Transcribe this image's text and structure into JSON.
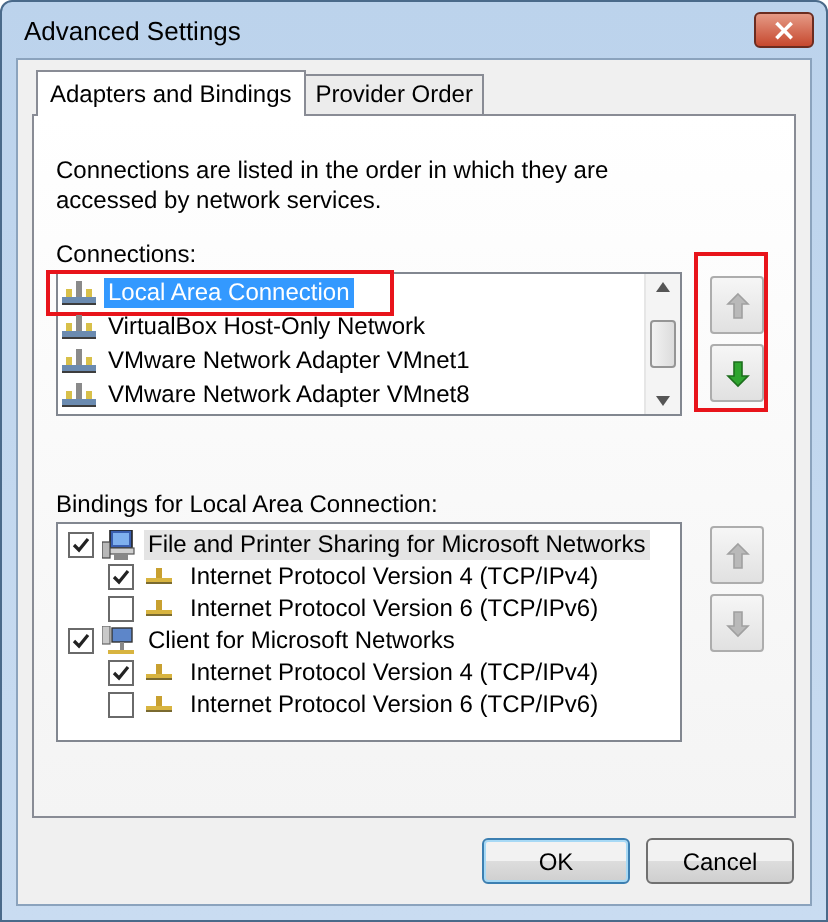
{
  "window": {
    "title": "Advanced Settings",
    "close_label": "×"
  },
  "tabs": [
    {
      "label": "Adapters and Bindings",
      "selected": true
    },
    {
      "label": "Provider Order",
      "selected": false
    }
  ],
  "description": "Connections are listed in the order in which they are accessed by network services.",
  "connections": {
    "label": "Connections:",
    "highlighted": true,
    "items": [
      {
        "name": "Local Area Connection",
        "selected": true,
        "highlighted": true
      },
      {
        "name": "VirtualBox Host-Only Network",
        "selected": false,
        "highlighted": false
      },
      {
        "name": "VMware Network Adapter VMnet1",
        "selected": false,
        "highlighted": false
      },
      {
        "name": "VMware Network Adapter VMnet8",
        "selected": false,
        "highlighted": false
      }
    ],
    "move_up": {
      "disabled": true
    },
    "move_down": {
      "disabled": false
    }
  },
  "bindings": {
    "label": "Bindings for Local Area Connection:",
    "items": [
      {
        "name": "File and Printer Sharing for Microsoft Networks",
        "kind": "service",
        "checked": true,
        "selected": true,
        "children": [
          {
            "name": "Internet Protocol Version 4 (TCP/IPv4)",
            "kind": "protocol",
            "checked": true,
            "selected": false
          },
          {
            "name": "Internet Protocol Version 6 (TCP/IPv6)",
            "kind": "protocol",
            "checked": false,
            "selected": false
          }
        ]
      },
      {
        "name": "Client for Microsoft Networks",
        "kind": "client",
        "checked": true,
        "selected": false,
        "children": [
          {
            "name": "Internet Protocol Version 4 (TCP/IPv4)",
            "kind": "protocol",
            "checked": true,
            "selected": false
          },
          {
            "name": "Internet Protocol Version 6 (TCP/IPv6)",
            "kind": "protocol",
            "checked": false,
            "selected": false
          }
        ]
      }
    ],
    "move_up": {
      "disabled": true
    },
    "move_down": {
      "disabled": true
    }
  },
  "buttons": [
    "OK",
    "Cancel"
  ]
}
